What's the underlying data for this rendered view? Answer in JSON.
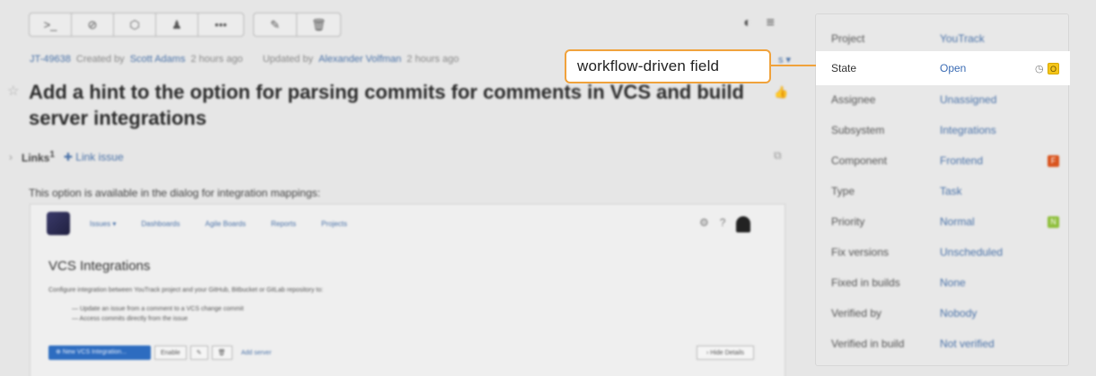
{
  "toolbar": {
    "group1": [
      {
        "icon": "command-icon",
        "glyph": ">_"
      },
      {
        "icon": "link-icon",
        "glyph": "⊘"
      },
      {
        "icon": "tag-icon",
        "glyph": "⬡"
      },
      {
        "icon": "user-icon",
        "glyph": "♟"
      },
      {
        "icon": "more-icon",
        "glyph": "•••"
      }
    ],
    "group2": [
      {
        "icon": "edit-icon",
        "glyph": "✎"
      },
      {
        "icon": "delete-icon",
        "glyph": "🗑"
      }
    ],
    "right_icons": [
      {
        "icon": "contrast-icon",
        "glyph": "◐"
      },
      {
        "icon": "menu-icon",
        "glyph": "≡"
      }
    ]
  },
  "issue": {
    "id": "JT-49638",
    "created_prefix": "Created by",
    "created_by": "Scott Adams",
    "created_time": "2 hours ago",
    "updated_prefix": "Updated by",
    "updated_by": "Alexander Volfman",
    "updated_time": "2 hours ago",
    "meta_right": "s ▾",
    "title": "Add a hint to the option for parsing commits for comments in VCS and build server integrations",
    "links_label": "Links",
    "links_count": "1",
    "link_issue": "Link issue",
    "description": "This option is available in the dialog for integration mappings:"
  },
  "embed": {
    "nav": [
      "Issues ▾",
      "Dashboards",
      "Agile Boards",
      "Reports",
      "Projects"
    ],
    "heading": "VCS Integrations",
    "paragraph": "Configure integration between YouTrack project and your GitHub, Bitbucket or GitLab repository to:",
    "bullets": [
      "— Update an issue from a comment to a VCS change commit",
      "— Access commits directly from the issue"
    ],
    "primary_button": "⊕ New VCS Integration...",
    "enable_button": "Enable",
    "add_server": "Add server",
    "hide_details": "› Hide Details"
  },
  "fields": [
    {
      "label": "Project",
      "value": "YouTrack",
      "badge": "",
      "badge_color": ""
    },
    {
      "label": "State",
      "value": "Open",
      "badge": "O",
      "badge_color": "#f5c518"
    },
    {
      "label": "Assignee",
      "value": "Unassigned",
      "badge": "",
      "badge_color": ""
    },
    {
      "label": "Subsystem",
      "value": "Integrations",
      "badge": "",
      "badge_color": ""
    },
    {
      "label": "Component",
      "value": "Frontend",
      "badge": "F",
      "badge_color": "#d9541e"
    },
    {
      "label": "Type",
      "value": "Task",
      "badge": "",
      "badge_color": ""
    },
    {
      "label": "Priority",
      "value": "Normal",
      "badge": "N",
      "badge_color": "#8fbf3c"
    },
    {
      "label": "Fix versions",
      "value": "Unscheduled",
      "badge": "",
      "badge_color": ""
    },
    {
      "label": "Fixed in builds",
      "value": "None",
      "badge": "",
      "badge_color": ""
    },
    {
      "label": "Verified by",
      "value": "Nobody",
      "badge": "",
      "badge_color": ""
    },
    {
      "label": "Verified in build",
      "value": "Not verified",
      "badge": "",
      "badge_color": ""
    }
  ],
  "callout": {
    "text": "workflow-driven field"
  },
  "colors": {
    "accent": "#f0a23c",
    "link": "#4a72a8"
  }
}
